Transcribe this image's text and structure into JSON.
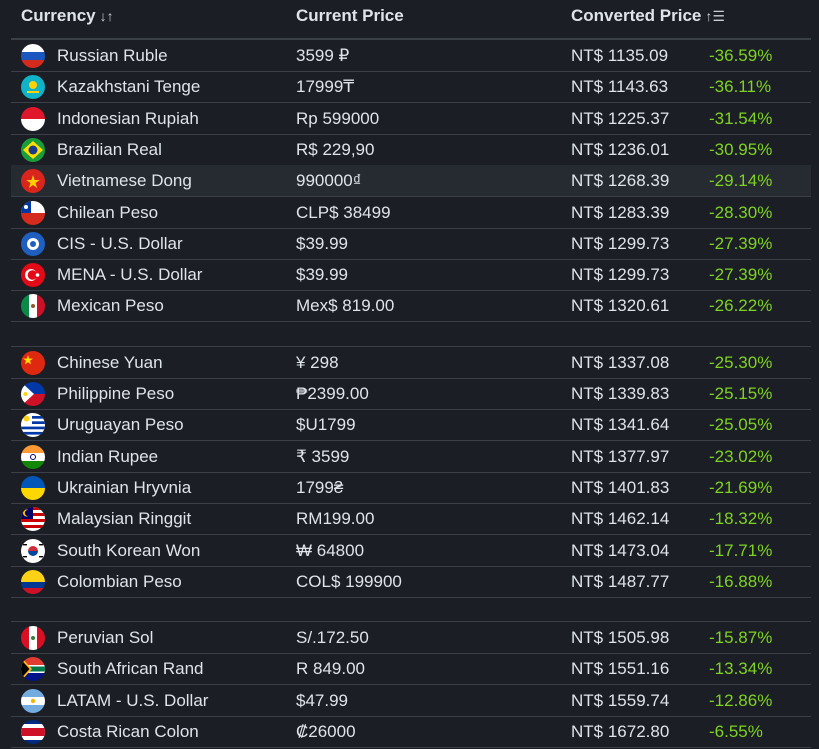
{
  "header": {
    "currency": "Currency",
    "current_price": "Current Price",
    "converted_price": "Converted Price",
    "currency_sort_icon": "sort-updown-icon",
    "converted_sort_icon": "sort-ascending-icon"
  },
  "colors": {
    "percent": "#7ed321",
    "background": "#1b1e24",
    "text": "#dfe3ea"
  },
  "groups": [
    [
      {
        "flag": "ru",
        "name": "Russian Ruble",
        "price": "3599 ₽",
        "converted": "NT$ 1135.09",
        "pct": "-36.59%"
      },
      {
        "flag": "kz",
        "name": "Kazakhstani Tenge",
        "price": "17999₸",
        "converted": "NT$ 1143.63",
        "pct": "-36.11%"
      },
      {
        "flag": "id",
        "name": "Indonesian Rupiah",
        "price": "Rp 599000",
        "converted": "NT$ 1225.37",
        "pct": "-31.54%"
      },
      {
        "flag": "br",
        "name": "Brazilian Real",
        "price": "R$ 229,90",
        "converted": "NT$ 1236.01",
        "pct": "-30.95%"
      },
      {
        "flag": "vn",
        "name": "Vietnamese Dong",
        "price": "990000₫",
        "converted": "NT$ 1268.39",
        "pct": "-29.14%"
      },
      {
        "flag": "cl",
        "name": "Chilean Peso",
        "price": "CLP$ 38499",
        "converted": "NT$ 1283.39",
        "pct": "-28.30%"
      },
      {
        "flag": "cis",
        "name": "CIS - U.S. Dollar",
        "price": "$39.99",
        "converted": "NT$ 1299.73",
        "pct": "-27.39%"
      },
      {
        "flag": "mena",
        "name": "MENA - U.S. Dollar",
        "price": "$39.99",
        "converted": "NT$ 1299.73",
        "pct": "-27.39%"
      },
      {
        "flag": "mx",
        "name": "Mexican Peso",
        "price": "Mex$ 819.00",
        "converted": "NT$ 1320.61",
        "pct": "-26.22%"
      }
    ],
    [
      {
        "flag": "cn",
        "name": "Chinese Yuan",
        "price": "¥ 298",
        "converted": "NT$ 1337.08",
        "pct": "-25.30%"
      },
      {
        "flag": "ph",
        "name": "Philippine Peso",
        "price": "₱2399.00",
        "converted": "NT$ 1339.83",
        "pct": "-25.15%"
      },
      {
        "flag": "uy",
        "name": "Uruguayan Peso",
        "price": "$U1799",
        "converted": "NT$ 1341.64",
        "pct": "-25.05%"
      },
      {
        "flag": "in",
        "name": "Indian Rupee",
        "price": "₹ 3599",
        "converted": "NT$ 1377.97",
        "pct": "-23.02%"
      },
      {
        "flag": "ua",
        "name": "Ukrainian Hryvnia",
        "price": "1799₴",
        "converted": "NT$ 1401.83",
        "pct": "-21.69%"
      },
      {
        "flag": "my",
        "name": "Malaysian Ringgit",
        "price": "RM199.00",
        "converted": "NT$ 1462.14",
        "pct": "-18.32%"
      },
      {
        "flag": "kr",
        "name": "South Korean Won",
        "price": "₩ 64800",
        "converted": "NT$ 1473.04",
        "pct": "-17.71%"
      },
      {
        "flag": "co",
        "name": "Colombian Peso",
        "price": "COL$ 199900",
        "converted": "NT$ 1487.77",
        "pct": "-16.88%"
      }
    ],
    [
      {
        "flag": "pe",
        "name": "Peruvian Sol",
        "price": "S/.172.50",
        "converted": "NT$ 1505.98",
        "pct": "-15.87%"
      },
      {
        "flag": "za",
        "name": "South African Rand",
        "price": "R 849.00",
        "converted": "NT$ 1551.16",
        "pct": "-13.34%"
      },
      {
        "flag": "ar",
        "name": "LATAM - U.S. Dollar",
        "price": "$47.99",
        "converted": "NT$ 1559.74",
        "pct": "-12.86%"
      },
      {
        "flag": "cr",
        "name": "Costa Rican Colon",
        "price": "₡26000",
        "converted": "NT$ 1672.80",
        "pct": "-6.55%"
      }
    ]
  ]
}
